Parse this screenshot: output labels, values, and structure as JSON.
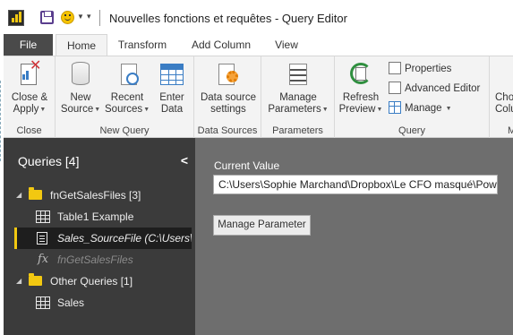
{
  "titlebar": {
    "title": "Nouvelles fonctions et requêtes - Query Editor",
    "icons": [
      "powerbi-app-icon",
      "save-icon",
      "smiley-icon",
      "dropdown-caret",
      "customize-quick-access"
    ]
  },
  "tabs": {
    "file": "File",
    "home": "Home",
    "transform": "Transform",
    "add_column": "Add Column",
    "view": "View",
    "active": "Home"
  },
  "ribbon": {
    "close_group": {
      "label": "Close",
      "close_apply": {
        "line1": "Close &",
        "line2": "Apply"
      }
    },
    "new_query_group": {
      "label": "New Query",
      "new_source": {
        "line1": "New",
        "line2": "Source"
      },
      "recent_sources": {
        "line1": "Recent",
        "line2": "Sources"
      },
      "enter_data": {
        "line1": "Enter",
        "line2": "Data"
      }
    },
    "data_sources_group": {
      "label": "Data Sources",
      "data_source_settings": {
        "line1": "Data source",
        "line2": "settings"
      }
    },
    "parameters_group": {
      "label": "Parameters",
      "manage_parameters": {
        "line1": "Manage",
        "line2": "Parameters"
      }
    },
    "query_group": {
      "label": "Query",
      "refresh_preview": {
        "line1": "Refresh",
        "line2": "Preview"
      },
      "properties": "Properties",
      "advanced_editor": "Advanced Editor",
      "manage": "Manage"
    },
    "cut_group": {
      "label": "Ma",
      "choose_columns": {
        "line1": "Cho",
        "line2": "Colu"
      }
    }
  },
  "queries_pane": {
    "header": "Queries [4]",
    "items": [
      {
        "type": "folder",
        "label": "fnGetSalesFiles [3]",
        "expanded": true
      },
      {
        "type": "table",
        "label": "Table1 Example"
      },
      {
        "type": "parameter",
        "label": "Sales_SourceFile (C:\\Users\\...",
        "selected": true
      },
      {
        "type": "function",
        "label": "fnGetSalesFiles"
      },
      {
        "type": "folder",
        "label": "Other Queries [1]",
        "expanded": true
      },
      {
        "type": "table",
        "label": "Sales"
      }
    ]
  },
  "main": {
    "current_value_label": "Current Value",
    "current_value": "C:\\Users\\Sophie Marchand\\Dropbox\\Le CFO masqué\\Powe",
    "manage_parameter_button": "Manage Parameter"
  },
  "colors": {
    "file_tab": "#4a4a4a",
    "ribbon_bg": "#f3f3f3",
    "queries_pane_bg": "#3b3b3b",
    "main_pane_bg": "#6e6e6e",
    "selection_accent": "#f2c811"
  }
}
